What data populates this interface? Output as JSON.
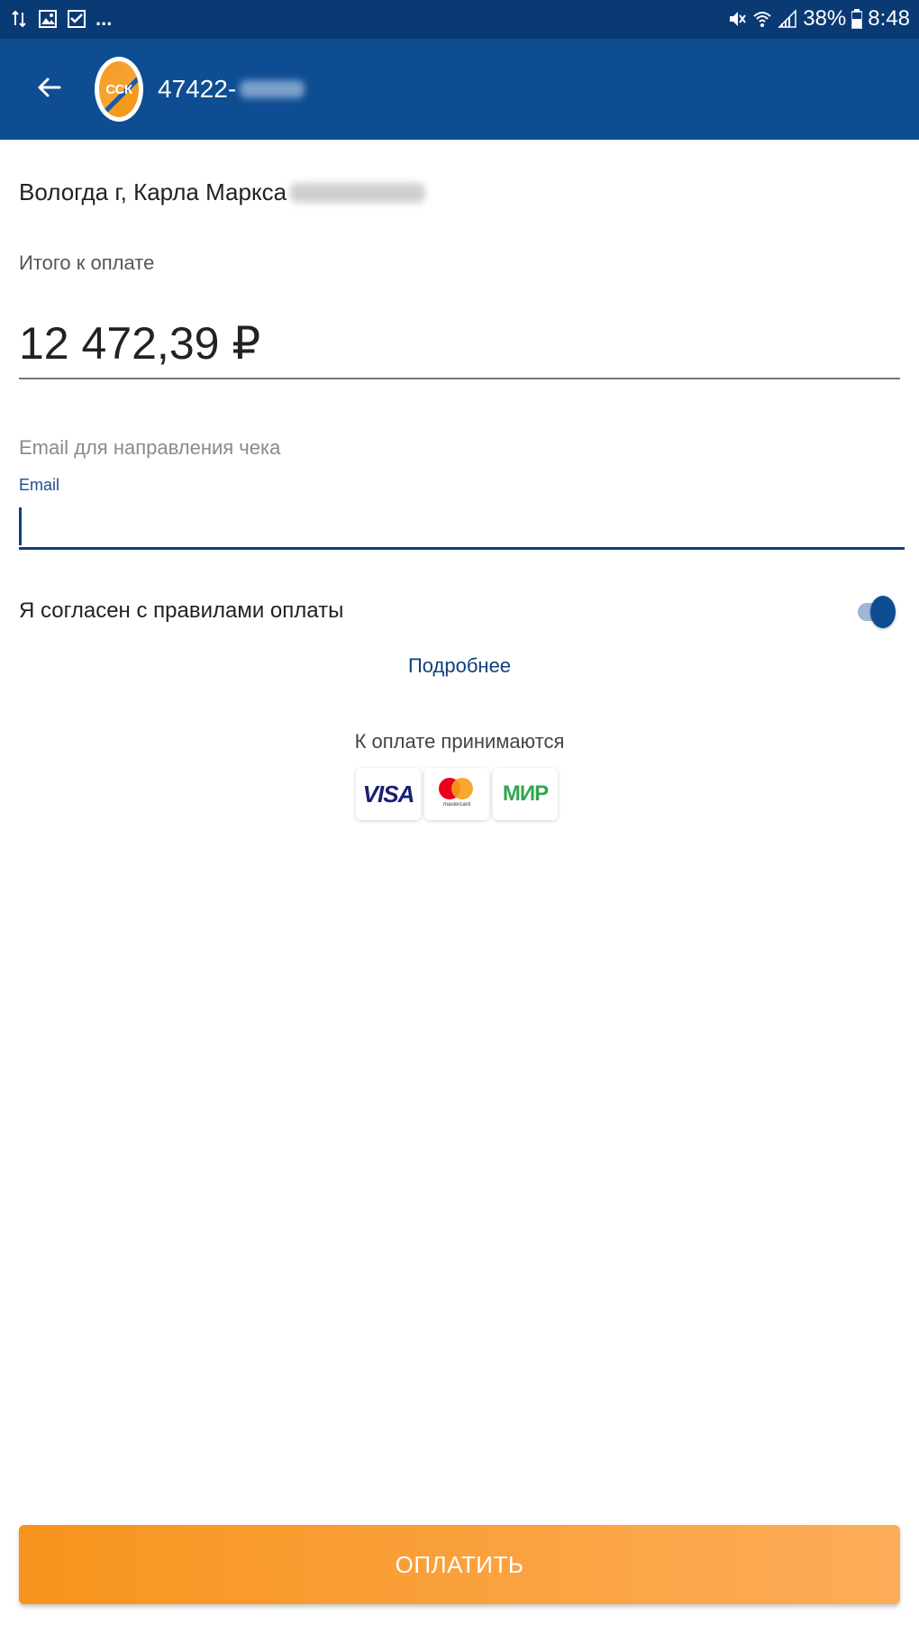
{
  "status_bar": {
    "battery": "38%",
    "time": "8:48",
    "icons": [
      "data-transfer-icon",
      "gallery-icon",
      "checkbox-mail-icon",
      "more-dots-icon",
      "mute-icon",
      "wifi-icon",
      "signal-icon",
      "battery-icon"
    ],
    "more_dots": "..."
  },
  "app_bar": {
    "back_icon": "back-arrow-icon",
    "logo_text": "ССК",
    "account_number": "47422-"
  },
  "form": {
    "address": "Вологда г, Карла Маркса",
    "total_label": "Итого к оплате",
    "amount": "12 472,39 ₽",
    "email_hint": "Email для направления чека",
    "email_label": "Email",
    "email_value": "",
    "agree_label": "Я согласен с правилами оплаты",
    "agree_enabled": true,
    "more_link": "Подробнее",
    "accepted_label": "К оплате принимаются",
    "cards": {
      "visa": "VISA",
      "mastercard": "mastercard",
      "mir": "МИР"
    },
    "pay_button": "ОПЛАТИТЬ"
  },
  "colors": {
    "status_bar": "#0a3a74",
    "app_bar": "#0e4d91",
    "accent_orange": "#f7941d",
    "link_blue": "#0e3f7d"
  }
}
